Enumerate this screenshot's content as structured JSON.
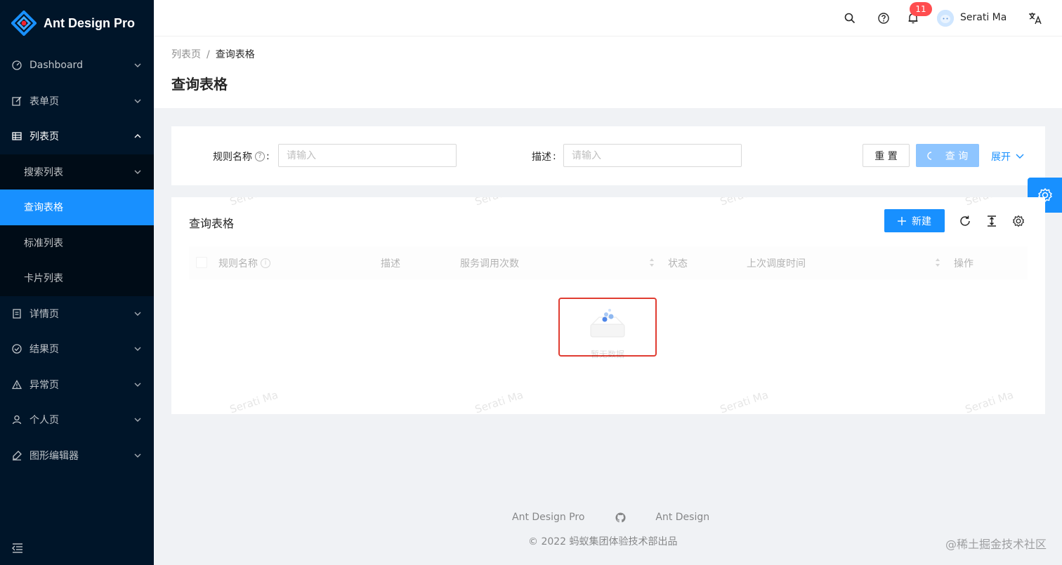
{
  "app": {
    "title": "Ant Design Pro"
  },
  "sidebar": {
    "items": [
      {
        "label": "Dashboard",
        "icon": "dashboard-icon"
      },
      {
        "label": "表单页",
        "icon": "form-icon"
      },
      {
        "label": "列表页",
        "icon": "table-icon"
      },
      {
        "label": "详情页",
        "icon": "profile-icon"
      },
      {
        "label": "结果页",
        "icon": "check-circle-icon"
      },
      {
        "label": "异常页",
        "icon": "warning-icon"
      },
      {
        "label": "个人页",
        "icon": "user-icon"
      },
      {
        "label": "图形编辑器",
        "icon": "highlight-icon"
      }
    ],
    "sub_items": [
      {
        "label": "搜索列表"
      },
      {
        "label": "查询表格"
      },
      {
        "label": "标准列表"
      },
      {
        "label": "卡片列表"
      }
    ]
  },
  "header": {
    "notification_count": "11",
    "username": "Serati Ma"
  },
  "breadcrumb": {
    "parent": "列表页",
    "separator": "/",
    "current": "查询表格"
  },
  "page": {
    "title": "查询表格"
  },
  "search_form": {
    "rule_name_label": "规则名称",
    "colon": ":",
    "rule_name_placeholder": "请输入",
    "desc_label": "描述",
    "desc_placeholder": "请输入",
    "reset_label": "重 置",
    "query_label": "查 询",
    "expand_label": "展开"
  },
  "table": {
    "title": "查询表格",
    "new_button_label": "新建",
    "columns": [
      "规则名称",
      "描述",
      "服务调用次数",
      "状态",
      "上次调度时间",
      "操作"
    ],
    "empty_text": "暂无数据"
  },
  "watermark": "Serati Ma",
  "footer": {
    "links": [
      "Ant Design Pro",
      "Ant Design"
    ],
    "copyright": "2022 蚂蚁集团体验技术部出品"
  },
  "corner_mark": "@稀土掘金技术社区",
  "colors": {
    "sidebar_bg": "#001529",
    "submenu_bg": "#000c17",
    "primary": "#1890ff",
    "badge": "#ff4d4f",
    "highlight_box": "#e03c31"
  }
}
